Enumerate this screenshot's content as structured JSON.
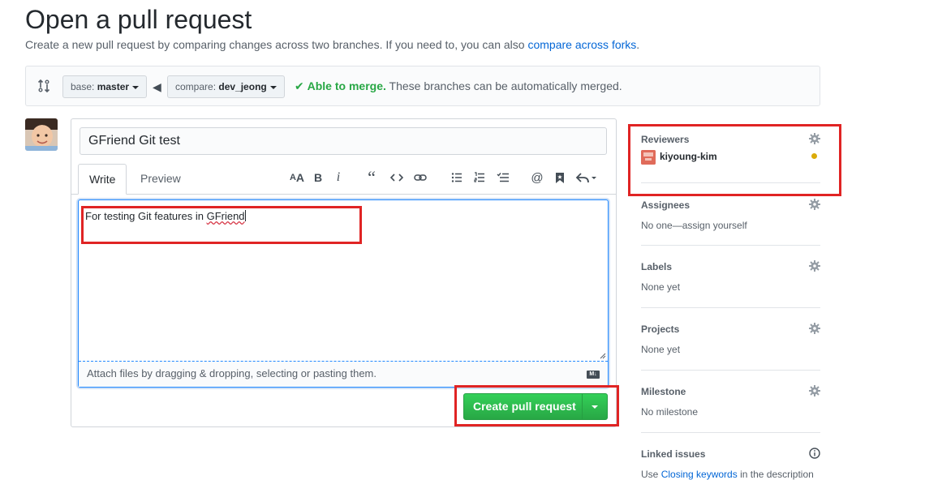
{
  "header": {
    "title": "Open a pull request",
    "subtitle_prefix": "Create a new pull request by comparing changes across two branches. If you need to, you can also",
    "subtitle_link": "compare across forks",
    "subtitle_suffix": "."
  },
  "range": {
    "base_prefix": "base:",
    "base_branch": "master",
    "compare_prefix": "compare:",
    "compare_branch": "dev_jeong",
    "merge_ok": "Able to merge.",
    "merge_desc": "These branches can be automatically merged."
  },
  "form": {
    "title_value": "GFriend Git test",
    "tabs": [
      "Write",
      "Preview"
    ],
    "toolbar_icons": [
      "header-icon",
      "bold-icon",
      "italic-icon",
      "quote-icon",
      "code-icon",
      "link-icon",
      "bullet-list-icon",
      "numbered-list-icon",
      "task-list-icon",
      "mention-icon",
      "saved-reply-icon",
      "reply-icon"
    ],
    "body_prefix": "For testing Git features in ",
    "body_spellcheck": "GFriend",
    "drop_hint": "Attach files by dragging & dropping, selecting or pasting them.",
    "markdown_badge": "M↓",
    "submit_label": "Create pull request"
  },
  "sidebar": {
    "reviewers": {
      "heading": "Reviewers",
      "items": [
        {
          "name": "kiyoung-kim",
          "status_color": "#dbab09"
        }
      ]
    },
    "assignees": {
      "heading": "Assignees",
      "text": "No one—assign yourself"
    },
    "labels": {
      "heading": "Labels",
      "text": "None yet"
    },
    "projects": {
      "heading": "Projects",
      "text": "None yet"
    },
    "milestone": {
      "heading": "Milestone",
      "text": "No milestone"
    },
    "linked_issues": {
      "heading": "Linked issues",
      "text_prefix": "Use",
      "text_link": "Closing keywords",
      "text_suffix": "in the description"
    }
  },
  "colors": {
    "accent_blue": "#0366d6",
    "merge_green": "#28a745",
    "annotation_red": "#e02424"
  }
}
